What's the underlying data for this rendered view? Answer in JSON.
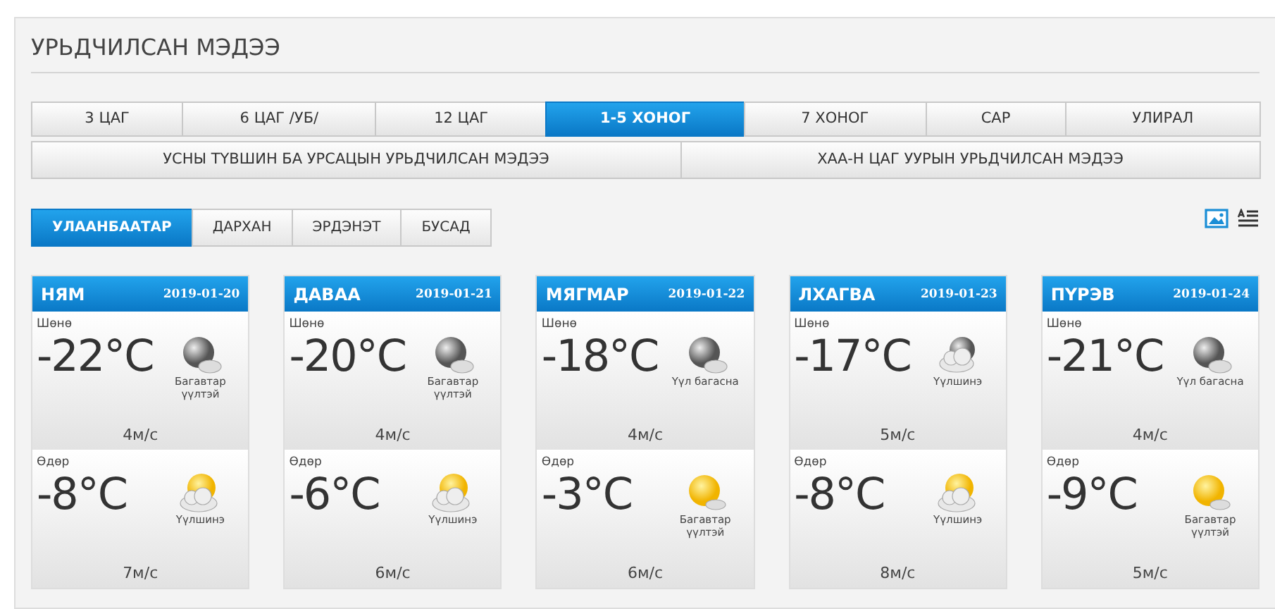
{
  "title": "УРЬДЧИЛСАН МЭДЭЭ",
  "period_tabs": [
    {
      "label": "3 ЦАГ",
      "selected": false
    },
    {
      "label": "6 ЦАГ /УБ/",
      "selected": false
    },
    {
      "label": "12 ЦАГ",
      "selected": false
    },
    {
      "label": "1-5 ХОНОГ",
      "selected": true
    },
    {
      "label": "7 ХОНОГ",
      "selected": false
    },
    {
      "label": "САР",
      "selected": false
    },
    {
      "label": "УЛИРАЛ",
      "selected": false
    }
  ],
  "forecast_links": [
    "УСНЫ ТҮВШИН БА УРСАЦЫН УРЬДЧИЛСАН МЭДЭЭ",
    "ХАА-Н ЦАГ УУРЫН УРЬДЧИЛСАН МЭДЭЭ"
  ],
  "city_tabs": [
    {
      "label": "УЛААНБААТАР",
      "selected": true
    },
    {
      "label": "ДАРХАН",
      "selected": false
    },
    {
      "label": "ЭРДЭНЭТ",
      "selected": false
    },
    {
      "label": "БУСАД",
      "selected": false
    }
  ],
  "days": [
    {
      "day": "НЯМ",
      "date": "2019-01-20",
      "night": {
        "label": "Шөнө",
        "temp": "-22°C",
        "kind": "moon",
        "condition": "Багавтар үүлтэй",
        "wind": "4м/с"
      },
      "daytime": {
        "label": "Өдөр",
        "temp": "-8°C",
        "kind": "sun-cloud",
        "condition": "Үүлшинэ",
        "wind": "7м/с"
      }
    },
    {
      "day": "ДАВАА",
      "date": "2019-01-21",
      "night": {
        "label": "Шөнө",
        "temp": "-20°C",
        "kind": "moon",
        "condition": "Багавтар үүлтэй",
        "wind": "4м/с"
      },
      "daytime": {
        "label": "Өдөр",
        "temp": "-6°C",
        "kind": "sun-cloud",
        "condition": "Үүлшинэ",
        "wind": "6м/с"
      }
    },
    {
      "day": "МЯГМАР",
      "date": "2019-01-22",
      "night": {
        "label": "Шөнө",
        "temp": "-18°C",
        "kind": "moon",
        "condition": "Үүл багасна",
        "wind": "4м/с"
      },
      "daytime": {
        "label": "Өдөр",
        "temp": "-3°C",
        "kind": "sun",
        "condition": "Багавтар үүлтэй",
        "wind": "6м/с"
      }
    },
    {
      "day": "ЛХАГВА",
      "date": "2019-01-23",
      "night": {
        "label": "Шөнө",
        "temp": "-17°C",
        "kind": "moon-cloud",
        "condition": "Үүлшинэ",
        "wind": "5м/с"
      },
      "daytime": {
        "label": "Өдөр",
        "temp": "-8°C",
        "kind": "sun-cloud",
        "condition": "Үүлшинэ",
        "wind": "8м/с"
      }
    },
    {
      "day": "ПҮРЭВ",
      "date": "2019-01-24",
      "night": {
        "label": "Шөнө",
        "temp": "-21°C",
        "kind": "moon",
        "condition": "Үүл багасна",
        "wind": "4м/с"
      },
      "daytime": {
        "label": "Өдөр",
        "temp": "-9°C",
        "kind": "sun",
        "condition": "Багавтар үүлтэй",
        "wind": "5м/с"
      }
    }
  ]
}
